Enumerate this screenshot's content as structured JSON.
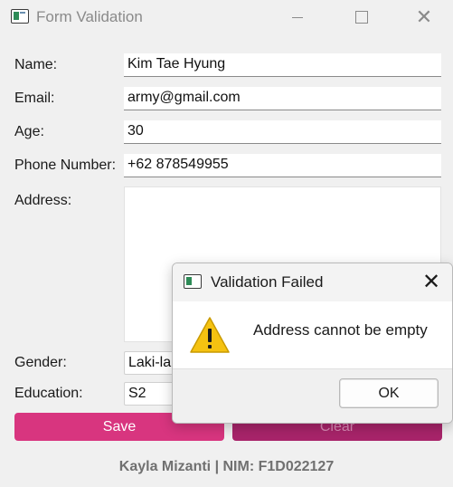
{
  "window": {
    "title": "Form Validation"
  },
  "form": {
    "name_label": "Name:",
    "name_value": "Kim Tae Hyung",
    "email_label": "Email:",
    "email_value": "army@gmail.com",
    "age_label": "Age:",
    "age_value": "30",
    "phone_label": "Phone Number:",
    "phone_value": "+62 878549955",
    "address_label": "Address:",
    "address_value": "",
    "gender_label": "Gender:",
    "gender_value": "Laki-laki",
    "education_label": "Education:",
    "education_value": "S2"
  },
  "buttons": {
    "save_label": "Save",
    "clear_label": "Clear"
  },
  "footer": {
    "text": "Kayla Mizanti | NIM: F1D022127"
  },
  "dialog": {
    "title": "Validation Failed",
    "message": "Address cannot be empty",
    "ok_label": "OK",
    "icon": "warning-icon"
  },
  "colors": {
    "save_button": "#d8357f",
    "clear_button": "#a8246a",
    "warning": "#f5c211"
  }
}
